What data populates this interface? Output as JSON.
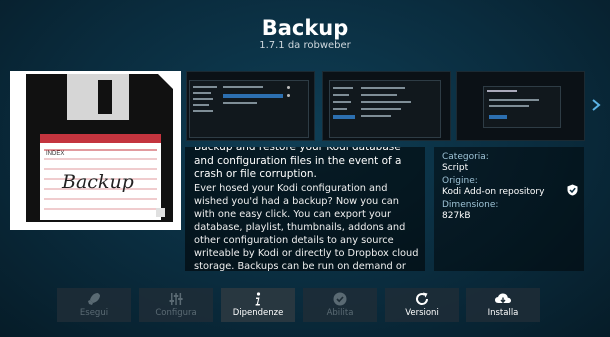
{
  "addon": {
    "name": "Backup",
    "version_line": "1.7.1 da robweber",
    "icon_label": "INDEX",
    "icon_text": "Backup"
  },
  "description": {
    "lead": "Backup and restore your Kodi database and configuration files in the event of a crash or file corruption.",
    "body": "Ever hosed your Kodi configuration and wished you'd had a backup? Now you can with one easy click. You can export your database, playlist, thumbnails, addons and other configuration details to any source writeable by Kodi or directly to Dropbox cloud storage. Backups can be run on demand or via a scheduler."
  },
  "info": {
    "category_label": "Categoria:",
    "category_value": "Script",
    "origin_label": "Origine:",
    "origin_value": "Kodi Add-on repository",
    "size_label": "Dimensione:",
    "size_value": "827kB"
  },
  "actions": [
    {
      "label": "Esegui",
      "icon": "rocket-icon",
      "enabled": false
    },
    {
      "label": "Configura",
      "icon": "sliders-icon",
      "enabled": false
    },
    {
      "label": "Dipendenze",
      "icon": "info-icon",
      "enabled": true
    },
    {
      "label": "Abilita",
      "icon": "check-circle-icon",
      "enabled": false
    },
    {
      "label": "Versioni",
      "icon": "refresh-icon",
      "enabled": true
    },
    {
      "label": "Installa",
      "icon": "cloud-download-icon",
      "enabled": true
    }
  ],
  "colors": {
    "background": "#0a2c3e",
    "label": "#9ec3d6",
    "accent": "#2c6fb0"
  }
}
